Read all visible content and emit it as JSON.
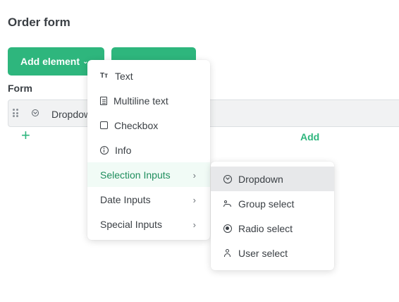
{
  "page": {
    "title": "Order form"
  },
  "toolbar": {
    "add_element_label": "Add element",
    "second_button_label": ""
  },
  "form": {
    "section_label": "Form",
    "row_label": "Dropdown",
    "add_row_symbol": "+",
    "add_link_label": "Add"
  },
  "menu": {
    "items": [
      {
        "label": "Text",
        "icon": "text-type-icon",
        "icon_glyph": "Tт"
      },
      {
        "label": "Multiline text",
        "icon": "multiline-text-icon"
      },
      {
        "label": "Checkbox",
        "icon": "checkbox-icon"
      },
      {
        "label": "Info",
        "icon": "info-icon"
      },
      {
        "label": "Selection Inputs",
        "submenu": true,
        "highlighted": true
      },
      {
        "label": "Date Inputs",
        "submenu": true
      },
      {
        "label": "Special Inputs",
        "submenu": true
      }
    ],
    "arrow_glyph": "›"
  },
  "submenu": {
    "items": [
      {
        "label": "Dropdown",
        "icon": "dropdown-icon",
        "hovered": true
      },
      {
        "label": "Group select",
        "icon": "group-icon"
      },
      {
        "label": "Radio select",
        "icon": "radio-icon"
      },
      {
        "label": "User select",
        "icon": "user-icon"
      }
    ]
  },
  "colors": {
    "accent": "#2eb67d",
    "highlight_bg": "#f1fbf6",
    "hover_bg": "#e7e8ea"
  }
}
